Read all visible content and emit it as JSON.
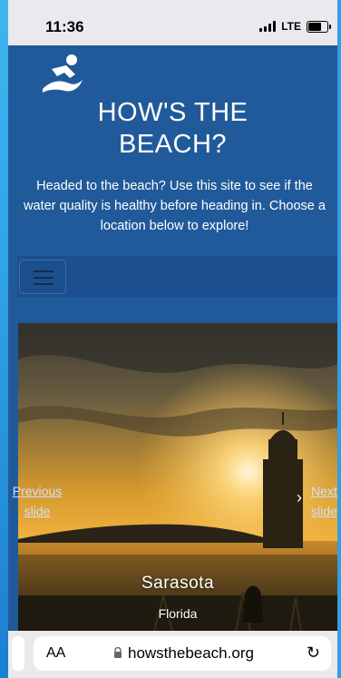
{
  "status_bar": {
    "time": "11:36",
    "network": "LTE",
    "battery_level": 0.8
  },
  "header": {
    "title_line1": "HOW'S THE",
    "title_line2": "BEACH?",
    "intro": "Headed to the beach? Use this site to see if the water quality is healthy before heading in. Choose a location below to explore!"
  },
  "navbar": {
    "toggle_icon": "hamburger-menu-icon"
  },
  "carousel": {
    "prev_label": "Previous slide",
    "next_label": "Next slide",
    "slide": {
      "city": "Sarasota",
      "state": "Florida"
    }
  },
  "browser": {
    "text_size_label": "AA",
    "url": "howsthebeach.org",
    "reload_icon": "reload-icon",
    "lock_icon": "lock-icon"
  },
  "colors": {
    "header_bg": "#215a9a",
    "navbar_bg": "#1c4f8f",
    "chrome": "#e9e9ee"
  }
}
